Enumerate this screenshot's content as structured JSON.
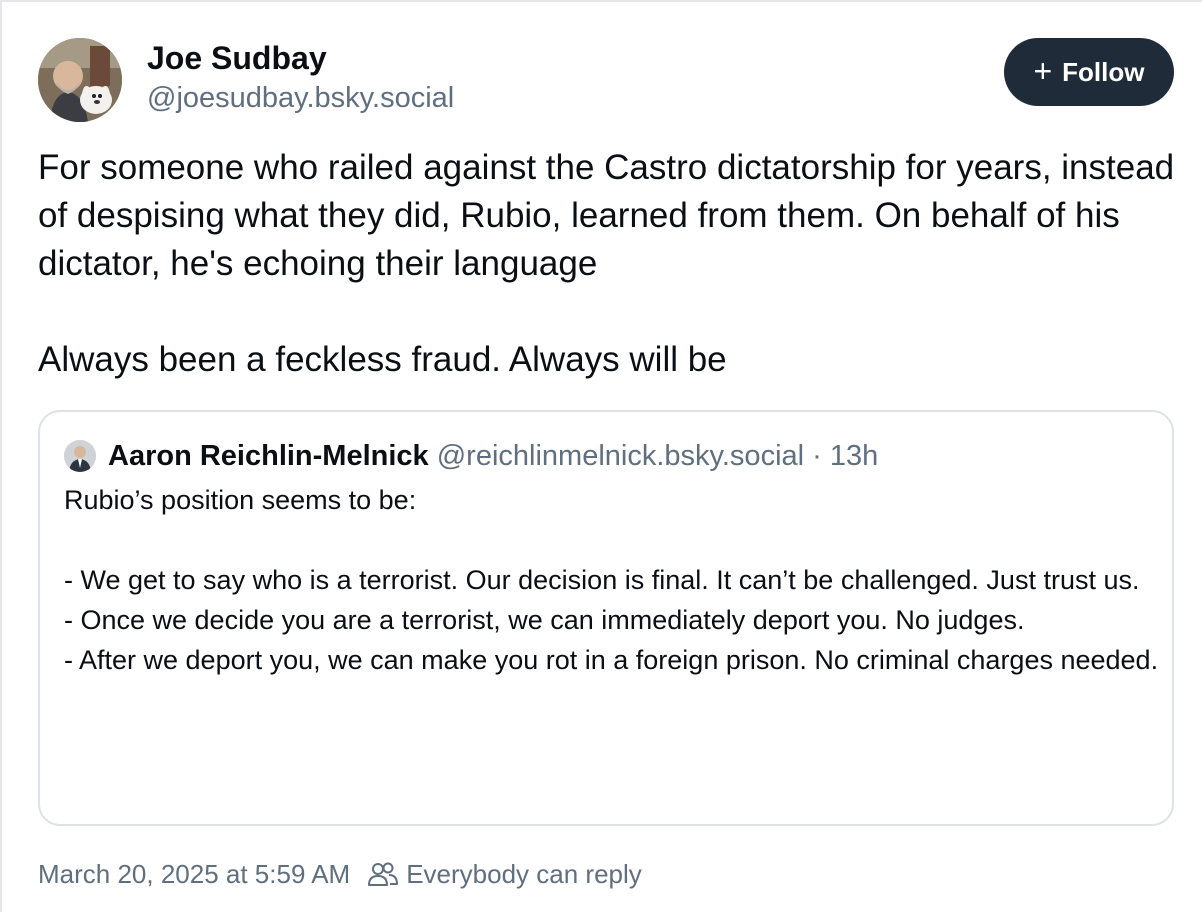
{
  "author": {
    "name": "Joe Sudbay",
    "handle": "@joesudbay.bsky.social"
  },
  "follow_button": {
    "label": "Follow",
    "icon": "plus-icon"
  },
  "post": {
    "paragraphs": [
      "For someone who railed against the Castro dictatorship for years, instead of despising what they did, Rubio, learned from them. On behalf of his dictator, he's echoing their language",
      "Always been a feckless fraud. Always will be"
    ]
  },
  "quote": {
    "author_name": "Aaron Reichlin-Melnick",
    "author_handle": "@reichlinmelnick.bsky.social",
    "separator": "·",
    "time": "13h",
    "lines": [
      "Rubio’s position seems to be:",
      "",
      "- We get to say who is a terrorist. Our decision is final. It can’t be challenged. Just trust us.",
      "- Once we decide you are a terrorist, we can immediately deport you. No judges.",
      "- After we deport you, we can make you rot in a foreign prison. No criminal charges needed."
    ]
  },
  "footer": {
    "timestamp": "March 20, 2025 at 5:59 AM",
    "reply_setting": "Everybody can reply",
    "icon": "people-icon"
  },
  "colors": {
    "follow_bg": "#1f2b38",
    "muted_text": "#5f6f80",
    "border": "#dde2e7"
  }
}
